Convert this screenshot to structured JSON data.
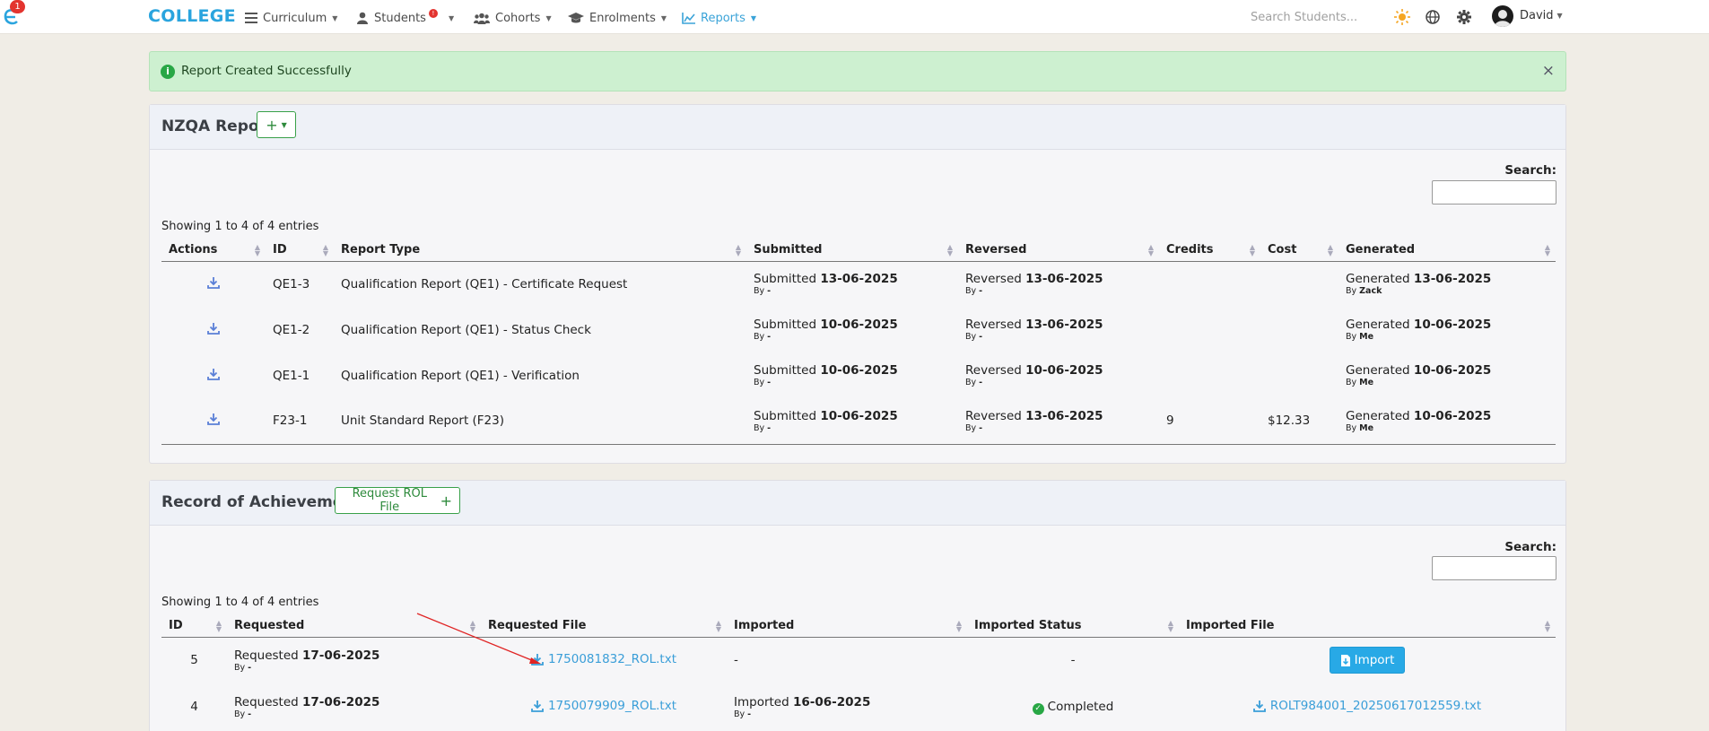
{
  "nav": {
    "logo_badge": "1",
    "brand": "COLLEGE",
    "items": [
      {
        "label": "Curriculum"
      },
      {
        "label": "Students",
        "badge": "!"
      },
      {
        "label": "Cohorts"
      },
      {
        "label": "Enrolments"
      },
      {
        "label": "Reports"
      }
    ],
    "search_placeholder": "Search Students...",
    "user": "David"
  },
  "alert": {
    "text": "Report Created Successfully",
    "close": "×"
  },
  "nzqa": {
    "title": "NZQA Report",
    "add_button": "+",
    "search_label": "Search:",
    "showing": "Showing 1 to 4 of 4 entries",
    "columns": [
      "Actions",
      "ID",
      "Report Type",
      "Submitted",
      "Reversed",
      "Credits",
      "Cost",
      "Generated"
    ],
    "rows": [
      {
        "id": "QE1-3",
        "type": "Qualification Report (QE1) - Certificate Request",
        "submitted_prefix": "Submitted",
        "submitted": "13-06-2025",
        "submitted_by": "-",
        "reversed_prefix": "Reversed",
        "reversed": "13-06-2025",
        "reversed_by": "-",
        "credits": "",
        "cost": "",
        "generated_prefix": "Generated",
        "generated": "13-06-2025",
        "generated_by": "Zack"
      },
      {
        "id": "QE1-2",
        "type": "Qualification Report (QE1) - Status Check",
        "submitted_prefix": "Submitted",
        "submitted": "10-06-2025",
        "submitted_by": "-",
        "reversed_prefix": "Reversed",
        "reversed": "13-06-2025",
        "reversed_by": "-",
        "credits": "",
        "cost": "",
        "generated_prefix": "Generated",
        "generated": "10-06-2025",
        "generated_by": "Me"
      },
      {
        "id": "QE1-1",
        "type": "Qualification Report (QE1) - Verification",
        "submitted_prefix": "Submitted",
        "submitted": "10-06-2025",
        "submitted_by": "-",
        "reversed_prefix": "Reversed",
        "reversed": "10-06-2025",
        "reversed_by": "-",
        "credits": "",
        "cost": "",
        "generated_prefix": "Generated",
        "generated": "10-06-2025",
        "generated_by": "Me"
      },
      {
        "id": "F23-1",
        "type": "Unit Standard Report (F23)",
        "submitted_prefix": "Submitted",
        "submitted": "10-06-2025",
        "submitted_by": "-",
        "reversed_prefix": "Reversed",
        "reversed": "13-06-2025",
        "reversed_by": "-",
        "credits": "9",
        "cost": "$12.33",
        "generated_prefix": "Generated",
        "generated": "10-06-2025",
        "generated_by": "Me"
      }
    ]
  },
  "rol": {
    "title": "Record of Achievement",
    "request_button": "Request ROL File",
    "search_label": "Search:",
    "showing": "Showing 1 to 4 of 4 entries",
    "columns": [
      "ID",
      "Requested",
      "Requested File",
      "Imported",
      "Imported Status",
      "Imported File"
    ],
    "rows": [
      {
        "id": "5",
        "requested_prefix": "Requested",
        "requested": "17-06-2025",
        "requested_by": "-",
        "file": "1750081832_ROL.txt",
        "imported": "-",
        "imported_by": "",
        "status": "-",
        "imported_file": "",
        "import_button": "Import"
      },
      {
        "id": "4",
        "requested_prefix": "Requested",
        "requested": "17-06-2025",
        "requested_by": "-",
        "file": "1750079909_ROL.txt",
        "imported_prefix": "Imported",
        "imported": "16-06-2025",
        "imported_by": "-",
        "status": "Completed",
        "imported_file": "ROLT984001_20250617012559.txt"
      }
    ]
  },
  "colors": {
    "brand": "#2aa4de",
    "success": "#28a745",
    "link": "#3a9ed8",
    "annotation": "#e02424"
  }
}
